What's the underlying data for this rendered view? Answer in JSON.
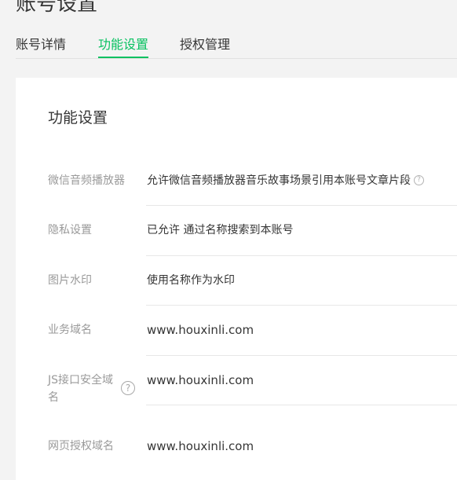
{
  "page": {
    "title": "账号设置"
  },
  "tabs": [
    {
      "label": "账号详情",
      "active": false
    },
    {
      "label": "功能设置",
      "active": true
    },
    {
      "label": "授权管理",
      "active": false
    }
  ],
  "card": {
    "title": "功能设置",
    "rows": [
      {
        "label": "微信音频播放器",
        "value": "允许微信音频播放器音乐故事场景引用本账号文章片段"
      },
      {
        "label": "隐私设置",
        "value": "已允许 通过名称搜索到本账号"
      },
      {
        "label": "图片水印",
        "value": "使用名称作为水印"
      },
      {
        "label": "业务域名",
        "value": "www.houxinli.com"
      },
      {
        "label": "JS接口安全域名",
        "value": "www.houxinli.com"
      },
      {
        "label": "网页授权域名",
        "value": "www.houxinli.com"
      }
    ]
  },
  "icons": {
    "help": "question-circle-icon",
    "help_glyph": "?"
  },
  "colors": {
    "accent": "#07c160",
    "label": "#9a9a9a",
    "text": "#353535"
  }
}
